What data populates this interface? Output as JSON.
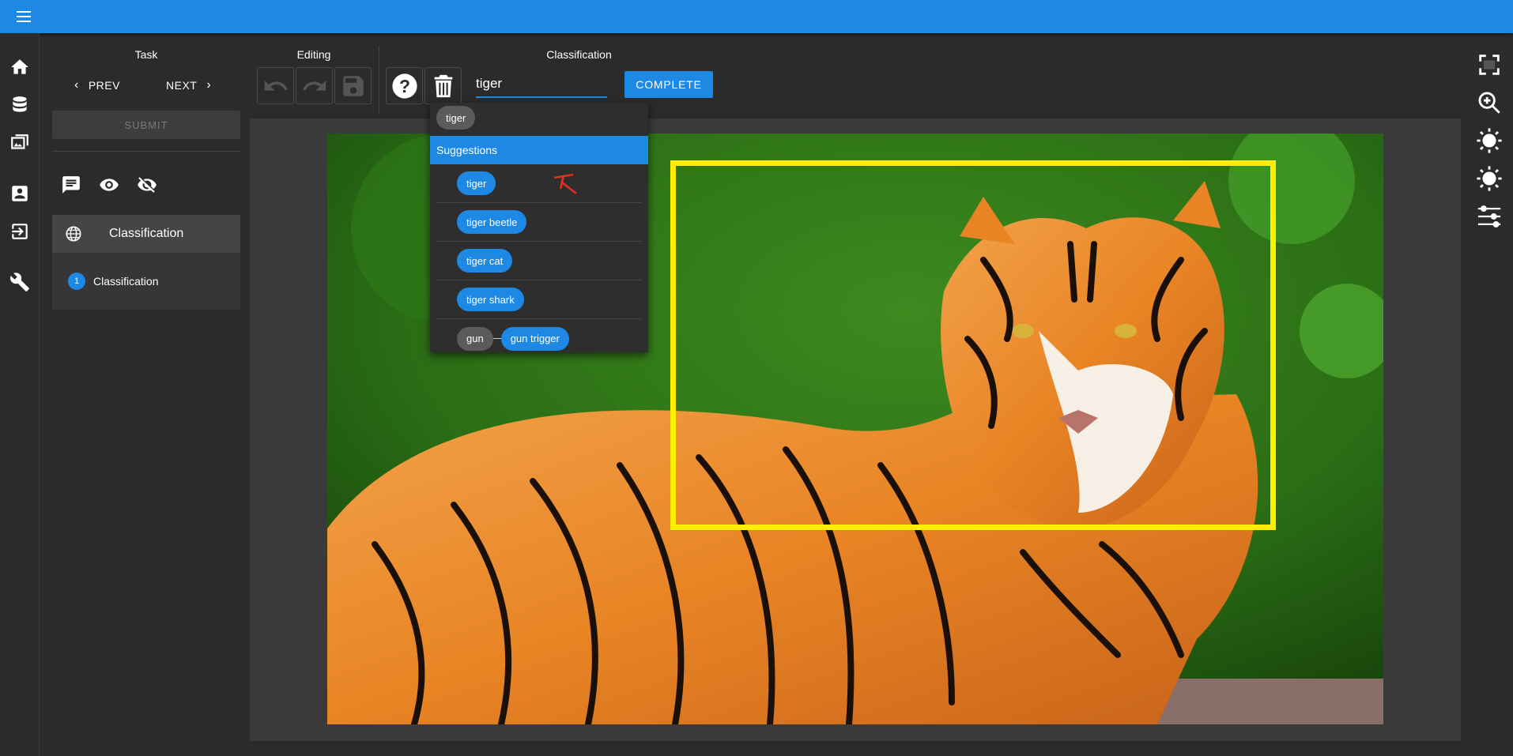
{
  "header": {
    "menu_icon": "hamburger-menu-icon",
    "bar_color": "#1e88e5"
  },
  "left_rail": {
    "icons": [
      "home-icon",
      "database-icon",
      "images-icon",
      "account-box-icon",
      "logout-icon",
      "wrench-icon"
    ]
  },
  "task": {
    "title": "Task",
    "prev_label": "PREV",
    "next_label": "NEXT",
    "submit_label": "SUBMIT"
  },
  "editing": {
    "title": "Editing"
  },
  "classification": {
    "title": "Classification",
    "input_value": "tiger",
    "complete_label": "COMPLETE"
  },
  "side": {
    "section_label": "Classification",
    "item_number": "1",
    "item_label": "Classification"
  },
  "dropdown": {
    "selected_chip": "tiger",
    "suggestions_header": "Suggestions",
    "suggestions": [
      "tiger",
      "tiger beetle",
      "tiger cat",
      "tiger shark"
    ],
    "parent_chip": "gun",
    "child_chip": "gun trigger"
  },
  "annotation": {
    "box_color": "#ffee00"
  }
}
